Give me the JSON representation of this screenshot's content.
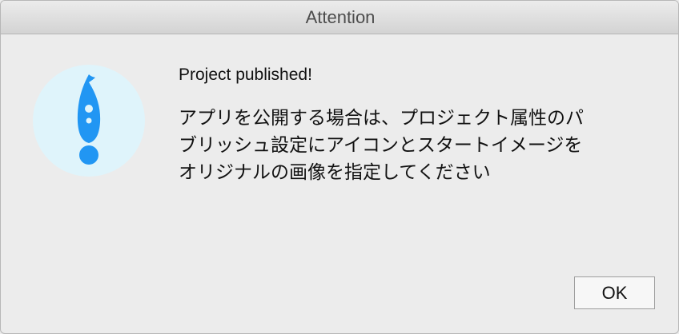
{
  "window": {
    "title": "Attention"
  },
  "icon": {
    "name": "rocket-exclamation-icon",
    "background_color": "#dff4fb",
    "icon_color": "#2196f3"
  },
  "dialog": {
    "heading": "Project published!",
    "message_lines": [
      "アプリを公開する場合は、プロジェクト属性のパ",
      "ブリッシュ設定にアイコンとスタートイメージを",
      "オリジナルの画像を指定してください"
    ]
  },
  "buttons": {
    "ok_label": "OK"
  }
}
